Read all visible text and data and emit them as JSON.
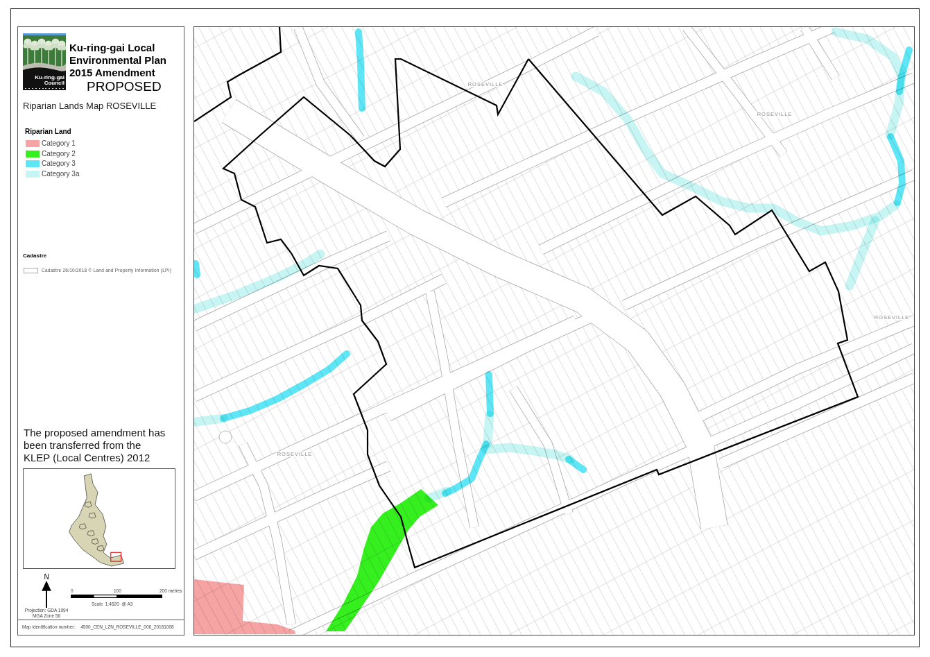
{
  "logo": {
    "lines": [
      "Ku-ring-gai",
      "Council"
    ]
  },
  "title": {
    "lines": [
      "Ku-ring-gai Local",
      "Environmental Plan",
      "2015 Amendment"
    ],
    "status": "PROPOSED"
  },
  "subtitle": "Riparian Lands Map ROSEVILLE",
  "legend": {
    "heading": "Riparian Land",
    "items": [
      {
        "label": "Category 1",
        "color": "#f6a3a3"
      },
      {
        "label": "Category 2",
        "color": "#35ef1f"
      },
      {
        "label": "Category 3",
        "color": "#5fe6f6"
      },
      {
        "label": "Category 3a",
        "color": "#c6f5f4"
      }
    ]
  },
  "cadastre": {
    "heading": "Cadastre",
    "items": [
      {
        "label": "Cadastre 26/10/2018 © Land and Property Information (LPI)"
      }
    ]
  },
  "note_lines": [
    "The proposed amendment has",
    "been transferred from the",
    "KLEP (Local Centres) 2012"
  ],
  "north_arrow": {
    "label": "N"
  },
  "projection": [
    "Projection: GDA 1994",
    "MGA Zone 56"
  ],
  "scale_bar": {
    "ticks": [
      "0",
      "100",
      "200 metres"
    ],
    "caption": "Scale  1:4620  @ A3"
  },
  "map_id": {
    "label": "Map identification number:",
    "value": "4500_CEN_LZN_ROSEVILLE_006_20181008"
  },
  "map": {
    "place_labels": [
      "ROSEVILLE",
      "ROSEVILLE",
      "ROSEVILLE",
      "ROSEVILLE"
    ]
  }
}
